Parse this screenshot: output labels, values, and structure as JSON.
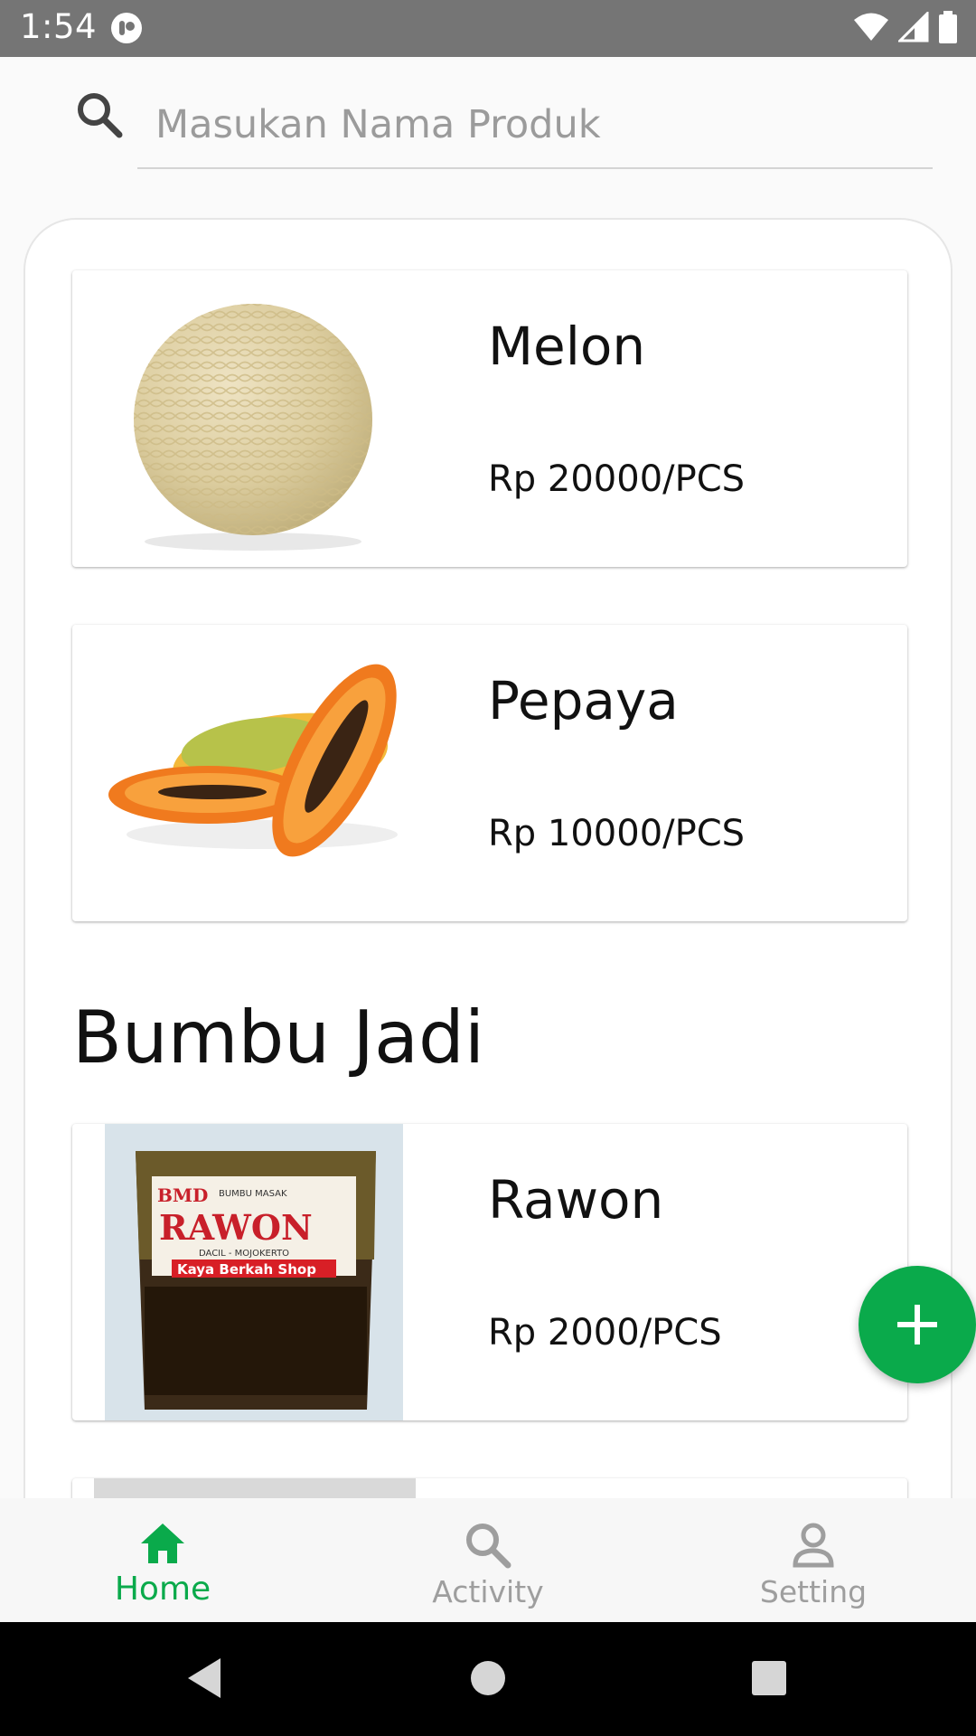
{
  "status_bar": {
    "time": "1:54"
  },
  "search": {
    "placeholder": "Masukan Nama Produk",
    "value": ""
  },
  "products": [
    {
      "name": "Melon",
      "price": "Rp 20000/PCS",
      "image_icon": "melon-image"
    },
    {
      "name": "Pepaya",
      "price": "Rp 10000/PCS",
      "image_icon": "papaya-image"
    }
  ],
  "section": {
    "title": "Bumbu Jadi",
    "products": [
      {
        "name": "Rawon",
        "price": "Rp 2000/PCS",
        "image_icon": "rawon-package-image",
        "package_text": {
          "brand": "BMD",
          "type": "BUMBU MASAK",
          "product": "RAWON",
          "sub": "DACIL - MOJOKERTO",
          "shop": "Kaya Berkah Shop"
        }
      }
    ]
  },
  "fab": {
    "icon": "plus-icon"
  },
  "bottom_nav": {
    "items": [
      {
        "label": "Home",
        "icon": "home-icon",
        "active": true
      },
      {
        "label": "Activity",
        "icon": "search-icon",
        "active": false
      },
      {
        "label": "Setting",
        "icon": "person-icon",
        "active": false
      }
    ]
  },
  "colors": {
    "accent": "#0aaa4b",
    "status_bar": "#757575",
    "inactive": "#9e9e9e"
  }
}
